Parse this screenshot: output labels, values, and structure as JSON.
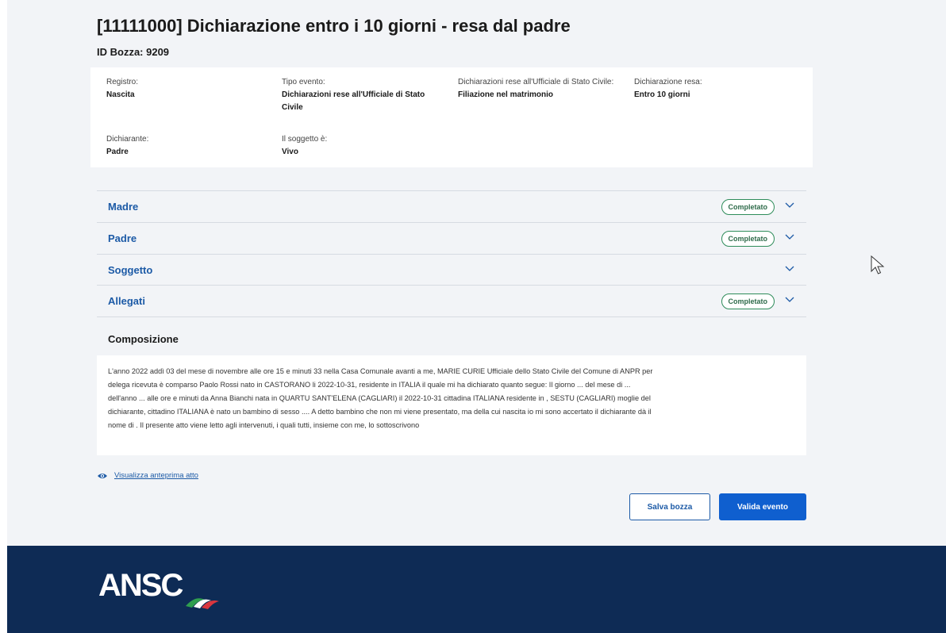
{
  "header": {
    "title": "[11111000] Dichiarazione entro i 10 giorni - resa dal padre",
    "draft_id": "ID Bozza: 9209"
  },
  "summary": {
    "fields": [
      {
        "label": "Registro:",
        "value": "Nascita"
      },
      {
        "label": "Tipo evento:",
        "value": "Dichiarazioni rese all'Ufficiale di Stato Civile"
      },
      {
        "label": "Dichiarazioni rese all'Ufficiale di Stato Civile:",
        "value": "Filiazione nel matrimonio"
      },
      {
        "label": "Dichiarazione resa:",
        "value": "Entro 10 giorni"
      },
      {
        "label": "Dichiarante:",
        "value": "Padre"
      },
      {
        "label": "Il soggetto è:",
        "value": "Vivo"
      }
    ]
  },
  "accordion": {
    "items": [
      {
        "label": "Madre",
        "badge": "Completato"
      },
      {
        "label": "Padre",
        "badge": "Completato"
      },
      {
        "label": "Soggetto",
        "badge": ""
      },
      {
        "label": "Allegati",
        "badge": "Completato"
      }
    ]
  },
  "composizione": {
    "title": "Composizione",
    "text": "L'anno 2022 addì 03 del mese di novembre alle ore 15 e minuti 33 nella Casa Comunale avanti a me, MARIE CURIE Ufficiale dello Stato Civile del Comune di ANPR per delega ricevuta è comparso Paolo Rossi nato in CASTORANO li 2022-10-31, residente in ITALIA il quale mi ha dichiarato quanto segue: Il giorno ... del mese di ... dell'anno ... alle ore e minuti da Anna Bianchi nata in QUARTU SANT'ELENA (CAGLIARI) il 2022-10-31 cittadina ITALIANA residente in , SESTU (CAGLIARI) moglie del dichiarante, cittadino ITALIANA è nato un bambino di sesso .... A detto bambino che non mi viene presentato, ma della cui nascita io mi sono accertato il dichiarante dà il nome di . Il presente atto viene letto agli intervenuti, i quali tutti, insieme con me, lo sottoscrivono"
  },
  "actions": {
    "preview_label": "Visualizza anteprima atto",
    "save_label": "Salva bozza",
    "validate_label": "Valida evento"
  },
  "footer": {
    "logo_text": "ANSC"
  },
  "icons": {
    "chevron": "chevron-down-icon",
    "eye": "eye-icon",
    "cursor": "mouse-pointer-icon"
  },
  "colors": {
    "link_blue": "#1c5aa6",
    "primary_button": "#0f5fcf",
    "badge_green": "#2e8c5a",
    "footer_navy": "#0e2b55",
    "page_background": "#f2f4f7"
  }
}
